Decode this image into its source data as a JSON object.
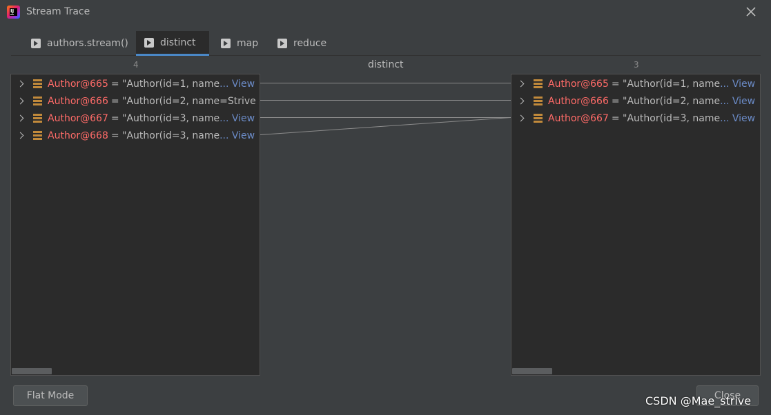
{
  "window": {
    "title": "Stream Trace"
  },
  "tabs": [
    {
      "label": "authors.stream()",
      "active": false
    },
    {
      "label": "distinct",
      "active": true
    },
    {
      "label": "map",
      "active": false
    },
    {
      "label": "reduce",
      "active": false
    }
  ],
  "columns": {
    "left_count": "4",
    "operation": "distinct",
    "right_count": "3"
  },
  "left_items": [
    {
      "name": "Author@665",
      "value": "= \"Author(id=1, name",
      "suffix": "... View"
    },
    {
      "name": "Author@666",
      "value": "= \"Author(id=2, name=Strive",
      "suffix": ""
    },
    {
      "name": "Author@667",
      "value": "= \"Author(id=3, name",
      "suffix": "... View"
    },
    {
      "name": "Author@668",
      "value": "= \"Author(id=3, name",
      "suffix": "... View"
    }
  ],
  "right_items": [
    {
      "name": "Author@665",
      "value": "= \"Author(id=1, name",
      "suffix": "... View"
    },
    {
      "name": "Author@666",
      "value": "= \"Author(id=2, name",
      "suffix": "... View"
    },
    {
      "name": "Author@667",
      "value": "= \"Author(id=3, name",
      "suffix": "... View"
    }
  ],
  "mapping": [
    [
      0,
      0
    ],
    [
      1,
      1
    ],
    [
      2,
      2
    ],
    [
      3,
      2
    ]
  ],
  "buttons": {
    "flat_mode": "Flat Mode",
    "close": "Close"
  },
  "watermark": "CSDN @Mae_strive",
  "colors": {
    "background": "#3c3f41",
    "panel": "#2b2b2b",
    "object_name": "#ff6b68",
    "link": "#6b8bc7",
    "tab_accent": "#4a88c7",
    "object_icon": "#c28a3b"
  }
}
